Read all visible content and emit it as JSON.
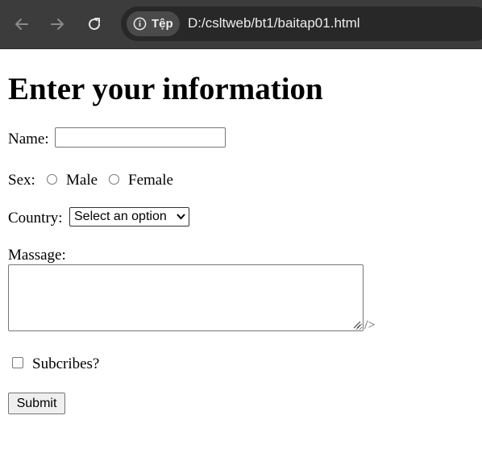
{
  "browser": {
    "chip_label": "Tệp",
    "url": "D:/csltweb/bt1/baitap01.html"
  },
  "page": {
    "title": "Enter your information",
    "name_label": "Name:",
    "name_value": "",
    "sex_label": "Sex:",
    "sex_options": [
      "Male",
      "Female"
    ],
    "country_label": "Country:",
    "country_selected": "Select an option",
    "message_label": "Massage:",
    "message_value": "",
    "message_tail": "/>",
    "subscribe_label": "Subcribes?",
    "submit_label": "Submit"
  },
  "icons": {
    "back": "arrow-left-icon",
    "forward": "arrow-right-icon",
    "reload": "reload-icon",
    "info": "info-icon",
    "dropdown": "chevron-down-icon"
  }
}
